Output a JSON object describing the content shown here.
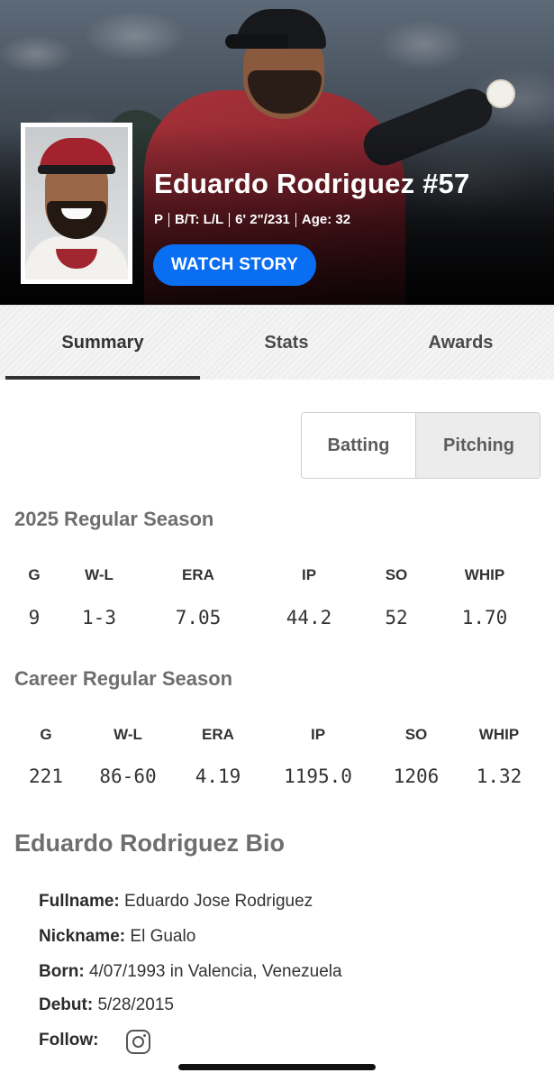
{
  "hero": {
    "player_name": "Eduardo Rodriguez #57",
    "position": "P",
    "bats_throws": "B/T: L/L",
    "height_weight": "6' 2\"/231",
    "age": "Age: 32",
    "watch_story_label": "WATCH STORY"
  },
  "tabs": [
    {
      "label": "Summary",
      "active": true
    },
    {
      "label": "Stats",
      "active": false
    },
    {
      "label": "Awards",
      "active": false
    }
  ],
  "toggle": {
    "batting_label": "Batting",
    "pitching_label": "Pitching",
    "selected": "Pitching"
  },
  "season": {
    "title": "2025 Regular Season",
    "headers": [
      "G",
      "W-L",
      "ERA",
      "IP",
      "SO",
      "WHIP"
    ],
    "values": [
      "9",
      "1-3",
      "7.05",
      "44.2",
      "52",
      "1.70"
    ]
  },
  "career": {
    "title": "Career Regular Season",
    "headers": [
      "G",
      "W-L",
      "ERA",
      "IP",
      "SO",
      "WHIP"
    ],
    "values": [
      "221",
      "86-60",
      "4.19",
      "1195.0",
      "1206",
      "1.32"
    ]
  },
  "bio": {
    "title": "Eduardo Rodriguez Bio",
    "fullname_label": "Fullname:",
    "fullname": "Eduardo Jose Rodriguez",
    "nickname_label": "Nickname:",
    "nickname": "El Gualo",
    "born_label": "Born:",
    "born": "4/07/1993 in Valencia, Venezuela",
    "debut_label": "Debut:",
    "debut": "5/28/2015",
    "follow_label": "Follow:",
    "follow_icon": "instagram-icon"
  },
  "colors": {
    "accent_blue": "#0a6ef2",
    "team_red": "#a2232e"
  }
}
